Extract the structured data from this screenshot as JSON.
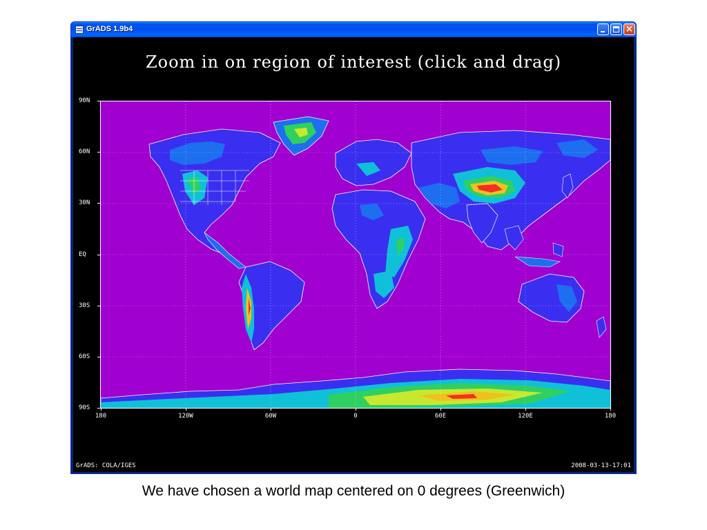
{
  "window": {
    "title": "GrADS 1.9b4",
    "icon": "app-icon",
    "controls": [
      "minimize-icon",
      "maximize-icon",
      "close-icon"
    ]
  },
  "grads": {
    "prompt": "Zoom in on region of interest (click and drag)",
    "lat_labels": [
      "90N",
      "60N",
      "30N",
      "EQ",
      "30S",
      "60S",
      "90S"
    ],
    "lon_labels": [
      "180",
      "120W",
      "60W",
      "0",
      "60E",
      "120E",
      "180"
    ],
    "footer_left": "GrADS: COLA/IGES",
    "footer_right": "2008-03-13-17:01",
    "colors": {
      "ocean": "#a000d0",
      "low": "#3a2ff0",
      "mid_low": "#1e6ef0",
      "mid": "#10c0d8",
      "mid_high": "#30d060",
      "high": "#c8e830",
      "higher": "#f0c020",
      "peak": "#f03020",
      "coastline": "#ffffff"
    }
  },
  "caption": "We have chosen a world map centered on 0 degrees (Greenwich)"
}
